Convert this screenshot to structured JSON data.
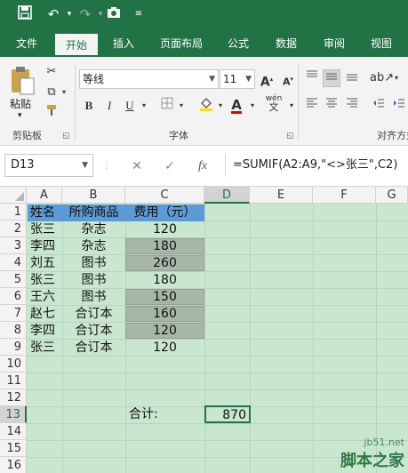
{
  "tabs": [
    "文件",
    "开始",
    "插入",
    "页面布局",
    "公式",
    "数据",
    "审阅",
    "视图"
  ],
  "ribbon": {
    "paste_label": "粘贴",
    "clipboard_label": "剪贴板",
    "font_name": "等线",
    "font_size": "11",
    "font_label": "字体",
    "align_label": "对齐方式",
    "bold": "B",
    "italic": "I",
    "underline": "U",
    "phonetic": "wén"
  },
  "formula_bar": {
    "name_box": "D13",
    "formula": "=SUMIF(A2:A9,\"<>张三\",C2)",
    "fx_label": "fx"
  },
  "columns": [
    "A",
    "B",
    "C",
    "D",
    "E",
    "F",
    "G"
  ],
  "rows": [
    "1",
    "2",
    "3",
    "4",
    "5",
    "6",
    "7",
    "8",
    "9",
    "10",
    "11",
    "12",
    "13",
    "14",
    "15",
    "16"
  ],
  "headers": [
    "姓名",
    "所购商品",
    "费用（元）"
  ],
  "data": [
    [
      "张三",
      "杂志",
      "120"
    ],
    [
      "李四",
      "杂志",
      "180"
    ],
    [
      "刘五",
      "图书",
      "260"
    ],
    [
      "张三",
      "图书",
      "180"
    ],
    [
      "王六",
      "图书",
      "150"
    ],
    [
      "赵七",
      "合订本",
      "160"
    ],
    [
      "李四",
      "合订本",
      "120"
    ],
    [
      "张三",
      "合订本",
      "120"
    ]
  ],
  "total_label": "合计:",
  "total_value": "870",
  "watermark": {
    "line1": "jb51.net",
    "line2": "脚本之家"
  },
  "colors": {
    "accent": "#217346",
    "header_fill": "#5b9bd5",
    "sheet_bg": "#c9e6cf",
    "grey_fill": "#a6b7a8"
  }
}
